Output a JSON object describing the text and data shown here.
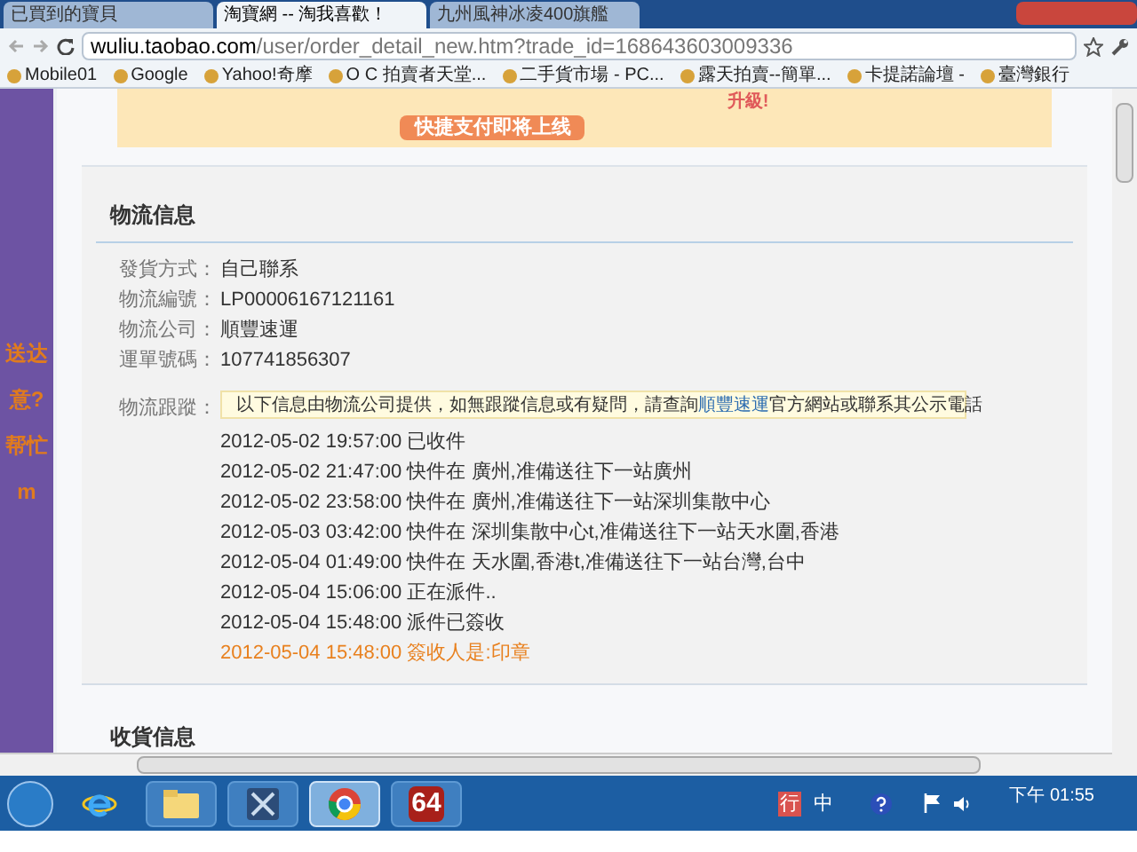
{
  "browser": {
    "tabs": [
      {
        "title": "已買到的寶貝",
        "selected": false
      },
      {
        "title": "淘寶網 -- 淘我喜歡！",
        "selected": true
      },
      {
        "title": "九州風神冰凌400旗艦",
        "selected": false
      }
    ],
    "address": {
      "host": "wuliu.taobao.com",
      "path": "/user/order_detail_new.htm?trade_id=168643603009336"
    },
    "bookmarks": [
      "Mobile01",
      "Google",
      "Yahoo!奇摩",
      "O C 拍賣者天堂...",
      "二手貨市場 - PC...",
      "露天拍賣--簡單...",
      "卡提諾論壇 -",
      "臺灣銀行"
    ]
  },
  "side_banner": {
    "texts": [
      "送达",
      "意?",
      "帮忙",
      "m"
    ]
  },
  "top_banner": {
    "slogan": "快捷支付即将上线",
    "badge": "升級!"
  },
  "logistics": {
    "title": "物流信息",
    "fields": [
      {
        "label": "發貨方式：",
        "value": "自己聯系"
      },
      {
        "label": "物流編號：",
        "value": "LP00006167121161"
      },
      {
        "label": "物流公司：",
        "value": "順豐速運"
      },
      {
        "label": "運單號碼：",
        "value": "107741856307"
      }
    ],
    "tracking_label": "物流跟蹤：",
    "notice": {
      "before": "以下信息由物流公司提供，如無跟蹤信息或有疑問，請查詢",
      "link": "順豐速運",
      "after": "官方網站或聯系其公示電話"
    },
    "events": [
      {
        "time": "2012-05-02 19:57:00",
        "text": "已收件",
        "latest": false
      },
      {
        "time": "2012-05-02 21:47:00",
        "text": "快件在 廣州,准備送往下一站廣州",
        "latest": false
      },
      {
        "time": "2012-05-02 23:58:00",
        "text": "快件在 廣州,准備送往下一站深圳集散中心",
        "latest": false
      },
      {
        "time": "2012-05-03 03:42:00",
        "text": "快件在 深圳集散中心t,准備送往下一站天水圍,香港",
        "latest": false
      },
      {
        "time": "2012-05-04 01:49:00",
        "text": "快件在 天水圍,香港t,准備送往下一站台灣,台中",
        "latest": false
      },
      {
        "time": "2012-05-04 15:06:00",
        "text": "正在派件..",
        "latest": false
      },
      {
        "time": "2012-05-04 15:48:00",
        "text": "派件已簽收",
        "latest": false
      },
      {
        "time": "2012-05-04 15:48:00",
        "text": "簽收人是:印章",
        "latest": true
      }
    ]
  },
  "receiving": {
    "title": "收貨信息"
  },
  "taskbar": {
    "apps": [
      {
        "kind": "ie",
        "active": false
      },
      {
        "kind": "folder",
        "active": false
      },
      {
        "kind": "xapp",
        "active": false
      },
      {
        "kind": "chrome",
        "active": true
      },
      {
        "kind": "badge",
        "label": "64",
        "active": false
      }
    ],
    "ime": [
      "行",
      "中"
    ],
    "clock": "下午 01:55"
  }
}
